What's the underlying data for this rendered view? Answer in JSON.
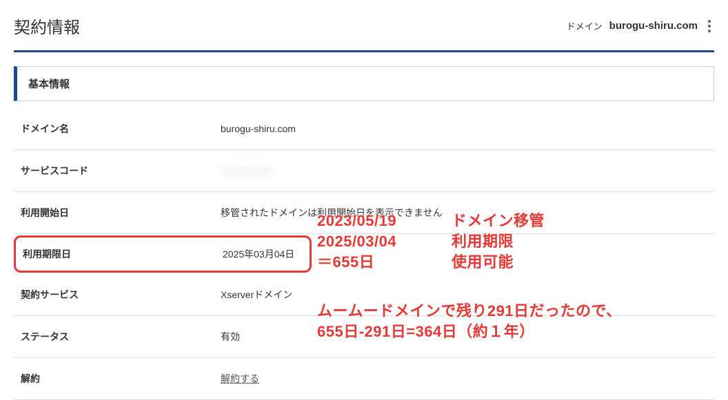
{
  "header": {
    "page_title": "契約情報",
    "domain_label": "ドメイン",
    "domain_name": "burogu-shiru.com"
  },
  "section": {
    "title": "基本情報"
  },
  "rows": {
    "domain_name": {
      "label": "ドメイン名",
      "value": "burogu-shiru.com"
    },
    "service_code": {
      "label": "サービスコード",
      "value": "XXXXXXXX"
    },
    "start_date": {
      "label": "利用開始日",
      "value": "移管されたドメインは利用開始日を表示できません"
    },
    "expiry_date": {
      "label": "利用期限日",
      "value": "2025年03月04日"
    },
    "contract_service": {
      "label": "契約サービス",
      "value": "Xserverドメイン"
    },
    "status": {
      "label": "ステータス",
      "value": "有効"
    },
    "cancellation": {
      "label": "解約",
      "value": "解約する"
    }
  },
  "annotations": {
    "line1a": "2023/05/19",
    "line1b": "ドメイン移管",
    "line2a": "2025/03/04",
    "line2b": "利用期限",
    "line3a": "＝655日",
    "line3b": "使用可能",
    "line4": "ムームードメインで残り291日だったので、",
    "line5": "655日-291日=364日（約１年）"
  }
}
